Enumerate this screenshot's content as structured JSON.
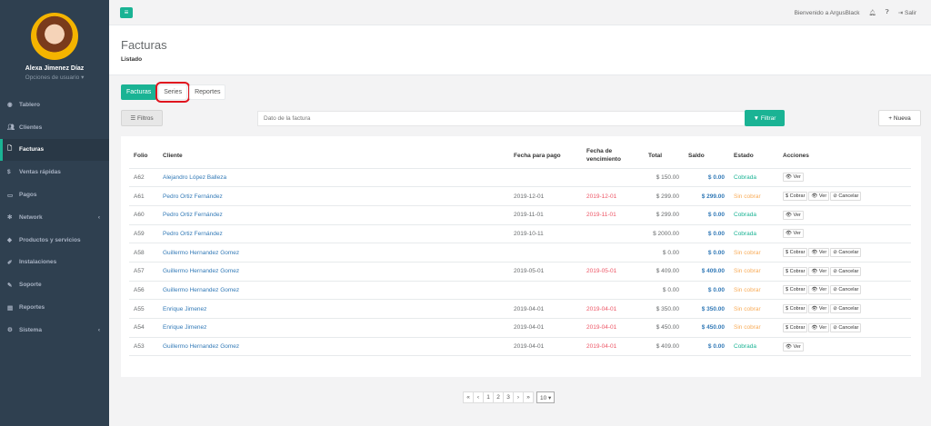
{
  "sidebar": {
    "profile_name": "Alexa Jimenez Díaz",
    "profile_options": "Opciones de usuario ▾",
    "items": [
      {
        "icon": "dashboard-icon",
        "label": "Tablero",
        "chevron": false,
        "active": false
      },
      {
        "icon": "users-icon",
        "label": "Clientes",
        "chevron": false,
        "active": false
      },
      {
        "icon": "file-icon",
        "label": "Facturas",
        "chevron": false,
        "active": true
      },
      {
        "icon": "dollar-icon",
        "label": "Ventas rápidas",
        "chevron": false,
        "active": false
      },
      {
        "icon": "money-icon",
        "label": "Pagos",
        "chevron": false,
        "active": false
      },
      {
        "icon": "network-icon",
        "label": "Network",
        "chevron": true,
        "active": false
      },
      {
        "icon": "tag-icon",
        "label": "Productos y servicios",
        "chevron": false,
        "active": false
      },
      {
        "icon": "wrench-icon",
        "label": "Instalaciones",
        "chevron": false,
        "active": false
      },
      {
        "icon": "support-icon",
        "label": "Soporte",
        "chevron": false,
        "active": false
      },
      {
        "icon": "report-icon",
        "label": "Reportes",
        "chevron": false,
        "active": false
      },
      {
        "icon": "gears-icon",
        "label": "Sistema",
        "chevron": true,
        "active": false
      }
    ]
  },
  "topbar": {
    "menu_glyph": "≡",
    "welcome": "Bienvenido a ArgusBlack",
    "logout": "Salir"
  },
  "page": {
    "title": "Facturas",
    "subtitle": "Listado"
  },
  "tabs": [
    "Facturas",
    "Series",
    "Reportes"
  ],
  "filters": {
    "filtros_label": "Filtros",
    "search_placeholder": "Dato de la factura",
    "filtrar_label": "Filtrar",
    "nueva_label": "Nueva"
  },
  "table": {
    "headers": [
      "Folio",
      "Cliente",
      "Fecha para pago",
      "Fecha de vencimiento",
      "Total",
      "Saldo",
      "Estado",
      "Acciones"
    ],
    "rows": [
      {
        "folio": "A62",
        "cliente": "Alejandro López Balleza",
        "pago": "",
        "venc": "",
        "total": "$ 150.00",
        "saldo": "$ 0.00",
        "estado": "Cobrada",
        "acciones": [
          "Ver"
        ]
      },
      {
        "folio": "A61",
        "cliente": "Pedro Ortiz Fernández",
        "pago": "2019-12-01",
        "venc": "2019-12-01",
        "total": "$ 299.00",
        "saldo": "$ 299.00",
        "estado": "Sin cobrar",
        "acciones": [
          "Cobrar",
          "Ver",
          "Cancelar"
        ]
      },
      {
        "folio": "A60",
        "cliente": "Pedro Ortiz Fernández",
        "pago": "2019-11-01",
        "venc": "2019-11-01",
        "total": "$ 299.00",
        "saldo": "$ 0.00",
        "estado": "Cobrada",
        "acciones": [
          "Ver"
        ]
      },
      {
        "folio": "A59",
        "cliente": "Pedro Ortiz Fernández",
        "pago": "2019-10-11",
        "venc": "",
        "total": "$ 2000.00",
        "saldo": "$ 0.00",
        "estado": "Cobrada",
        "acciones": [
          "Ver"
        ]
      },
      {
        "folio": "A58",
        "cliente": "Guillermo Hernandez Gomez",
        "pago": "",
        "venc": "",
        "total": "$ 0.00",
        "saldo": "$ 0.00",
        "estado": "Sin cobrar",
        "acciones": [
          "Cobrar",
          "Ver",
          "Cancelar"
        ]
      },
      {
        "folio": "A57",
        "cliente": "Guillermo Hernandez Gomez",
        "pago": "2019-05-01",
        "venc": "2019-05-01",
        "total": "$ 409.00",
        "saldo": "$ 409.00",
        "estado": "Sin cobrar",
        "acciones": [
          "Cobrar",
          "Ver",
          "Cancelar"
        ]
      },
      {
        "folio": "A56",
        "cliente": "Guillermo Hernandez Gomez",
        "pago": "",
        "venc": "",
        "total": "$ 0.00",
        "saldo": "$ 0.00",
        "estado": "Sin cobrar",
        "acciones": [
          "Cobrar",
          "Ver",
          "Cancelar"
        ]
      },
      {
        "folio": "A55",
        "cliente": "Enrique Jimenez",
        "pago": "2019-04-01",
        "venc": "2019-04-01",
        "total": "$ 350.00",
        "saldo": "$ 350.00",
        "estado": "Sin cobrar",
        "acciones": [
          "Cobrar",
          "Ver",
          "Cancelar"
        ]
      },
      {
        "folio": "A54",
        "cliente": "Enrique Jimenez",
        "pago": "2019-04-01",
        "venc": "2019-04-01",
        "total": "$ 450.00",
        "saldo": "$ 450.00",
        "estado": "Sin cobrar",
        "acciones": [
          "Cobrar",
          "Ver",
          "Cancelar"
        ]
      },
      {
        "folio": "A53",
        "cliente": "Guillermo Hernandez Gomez",
        "pago": "2019-04-01",
        "venc": "2019-04-01",
        "total": "$ 409.00",
        "saldo": "$ 0.00",
        "estado": "Cobrada",
        "acciones": [
          "Ver"
        ]
      }
    ]
  },
  "pagination": {
    "items": [
      "«",
      "‹",
      "1",
      "2",
      "3",
      "›",
      "»"
    ],
    "page_size": "10 ▾"
  },
  "colors": {
    "accent": "#1ab394",
    "sidebar": "#2f4050",
    "link": "#337ab7",
    "danger": "#ed5565",
    "warning": "#f8ac59"
  }
}
